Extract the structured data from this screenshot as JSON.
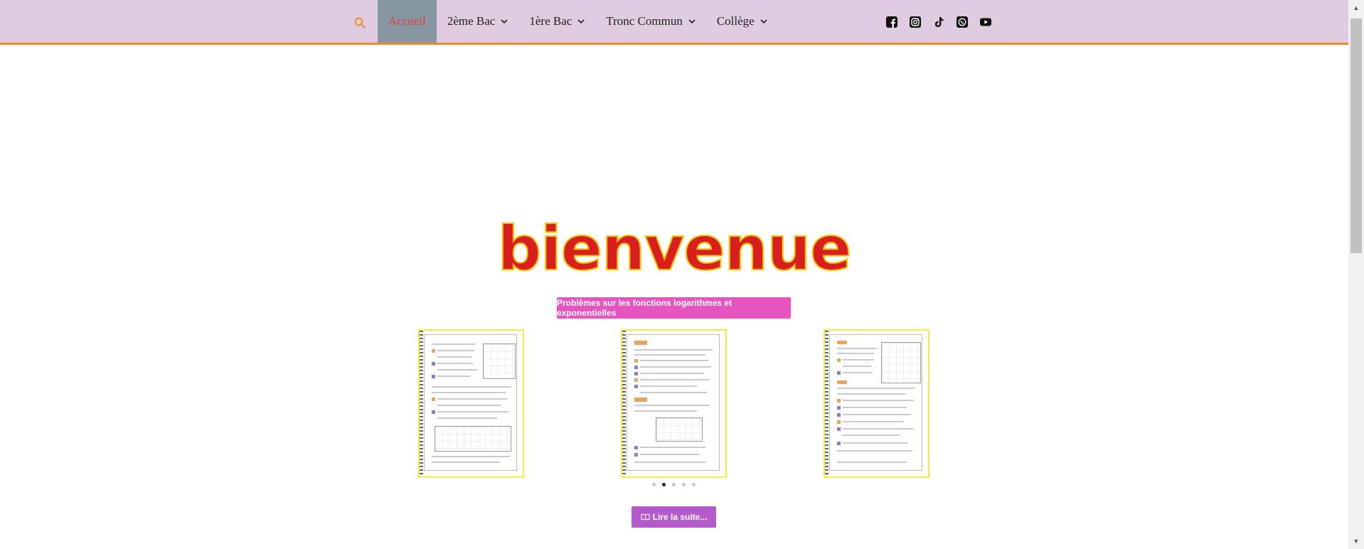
{
  "nav": {
    "items": [
      {
        "label": "Accueil",
        "active": true,
        "has_dropdown": false
      },
      {
        "label": "2ème Bac",
        "active": false,
        "has_dropdown": true
      },
      {
        "label": "1ère Bac",
        "active": false,
        "has_dropdown": true
      },
      {
        "label": "Tronc Commun",
        "active": false,
        "has_dropdown": true
      },
      {
        "label": "Collège",
        "active": false,
        "has_dropdown": true
      }
    ],
    "search_icon": "search-icon",
    "socials": [
      "facebook-icon",
      "instagram-icon",
      "tiktok-icon",
      "whatsapp-icon",
      "youtube-icon"
    ]
  },
  "hero": {
    "title": "bienvenue"
  },
  "featured": {
    "article_label": "Problèmes sur les fonctions logarithmes et exponentielles",
    "read_more_label": "Lire la suite...",
    "read_more_icon": "book-icon",
    "slider": {
      "dot_count": 5,
      "active_index": 1
    }
  },
  "colors": {
    "header_bg": "#e0cce0",
    "header_border": "#f28a2c",
    "active_nav_bg": "#8797a2",
    "active_nav_text": "#e83a3a",
    "article_button": "#e754c0",
    "read_more_button": "#b45bc9",
    "title_fill": "#d81e1e",
    "title_outline": "#f4c200",
    "thumb_border": "#f6ec3e"
  }
}
